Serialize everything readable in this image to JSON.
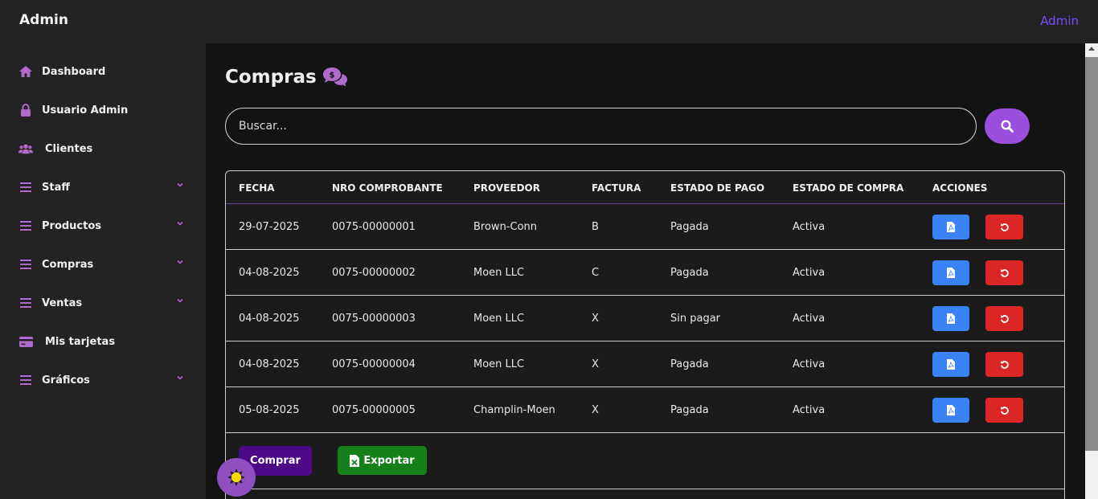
{
  "header": {
    "brand": "Admin",
    "user_link": "Admin"
  },
  "sidebar": {
    "items": [
      {
        "label": "Dashboard",
        "icon": "home-icon"
      },
      {
        "label": "Usuario Admin",
        "icon": "lock-icon"
      },
      {
        "label": "Clientes",
        "icon": "users-icon"
      },
      {
        "label": "Staff",
        "icon": "menu-icon",
        "expandable": true
      },
      {
        "label": "Productos",
        "icon": "menu-icon",
        "expandable": true
      },
      {
        "label": "Compras",
        "icon": "menu-icon",
        "expandable": true
      },
      {
        "label": "Ventas",
        "icon": "menu-icon",
        "expandable": true
      },
      {
        "label": "Mis tarjetas",
        "icon": "credit-card-icon"
      },
      {
        "label": "Gráficos",
        "icon": "menu-icon",
        "expandable": true
      }
    ]
  },
  "page": {
    "title": "Compras",
    "title_icon": "money-chat-icon"
  },
  "search": {
    "placeholder": "Buscar...",
    "value": ""
  },
  "table": {
    "headers": [
      "FECHA",
      "NRO COMPROBANTE",
      "PROVEEDOR",
      "FACTURA",
      "ESTADO DE PAGO",
      "ESTADO DE COMPRA",
      "ACCIONES"
    ],
    "rows": [
      {
        "fecha": "29-07-2025",
        "nro": "0075-00000001",
        "proveedor": "Brown-Conn",
        "factura": "B",
        "pago": "Pagada",
        "compra": "Activa"
      },
      {
        "fecha": "04-08-2025",
        "nro": "0075-00000002",
        "proveedor": "Moen LLC",
        "factura": "C",
        "pago": "Pagada",
        "compra": "Activa"
      },
      {
        "fecha": "04-08-2025",
        "nro": "0075-00000003",
        "proveedor": "Moen LLC",
        "factura": "X",
        "pago": "Sin pagar",
        "compra": "Activa"
      },
      {
        "fecha": "04-08-2025",
        "nro": "0075-00000004",
        "proveedor": "Moen LLC",
        "factura": "X",
        "pago": "Pagada",
        "compra": "Activa"
      },
      {
        "fecha": "05-08-2025",
        "nro": "0075-00000005",
        "proveedor": "Champlin-Moen",
        "factura": "X",
        "pago": "Pagada",
        "compra": "Activa"
      }
    ]
  },
  "actions": {
    "comprar_label": "Comprar",
    "exportar_label": "Exportar"
  },
  "colors": {
    "accent": "#9b4fdc",
    "link": "#7c4dff",
    "pdf_button": "#3b82f6",
    "undo_button": "#dc2626",
    "comprar": "#4c0a86",
    "exportar": "#15801a"
  }
}
